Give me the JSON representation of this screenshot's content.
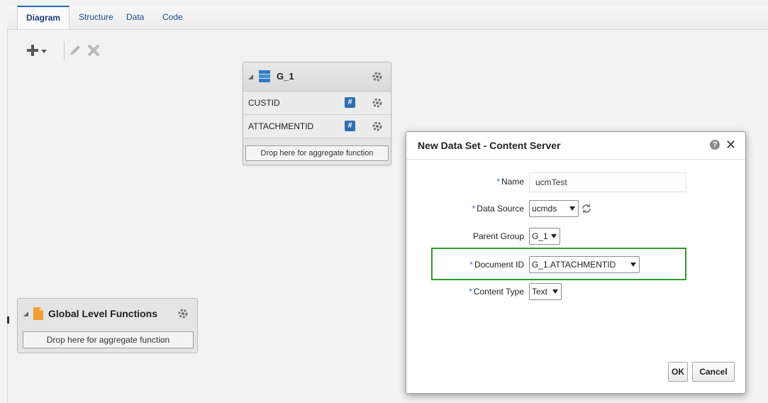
{
  "tabs": [
    {
      "label": "Diagram",
      "active": true
    },
    {
      "label": "Structure",
      "active": false
    },
    {
      "label": "Data",
      "active": false
    },
    {
      "label": "Code",
      "active": false
    }
  ],
  "toolbar": {
    "add_icon": "plus-dropdown-icon",
    "edit_icon": "pencil-icon",
    "delete_icon": "x-icon"
  },
  "group": {
    "title": "G_1",
    "fields": [
      {
        "name": "CUSTID",
        "type_icon": "#"
      },
      {
        "name": "ATTACHMENTID",
        "type_icon": "#"
      }
    ],
    "drop_label": "Drop here for aggregate function"
  },
  "global_functions": {
    "title": "Global Level Functions",
    "drop_label": "Drop here for aggregate function"
  },
  "dialog": {
    "title": "New Data Set - Content Server",
    "help_icon": "?",
    "close_icon": "✕",
    "required_mark": "*",
    "fields": {
      "name": {
        "label": "Name",
        "value": "ucmTest"
      },
      "data_source": {
        "label": "Data Source",
        "value": "ucmds"
      },
      "parent_group": {
        "label": "Parent Group",
        "value": "G_1"
      },
      "document_id": {
        "label": "Document ID",
        "value": "G_1.ATTACHMENTID"
      },
      "content_type": {
        "label": "Content Type",
        "value": "Text"
      }
    },
    "ok_label": "OK",
    "cancel_label": "Cancel"
  },
  "colors": {
    "accent": "#2a6ab8",
    "highlight": "#2e9a2e",
    "hash_icon": "#2f6fb0"
  }
}
